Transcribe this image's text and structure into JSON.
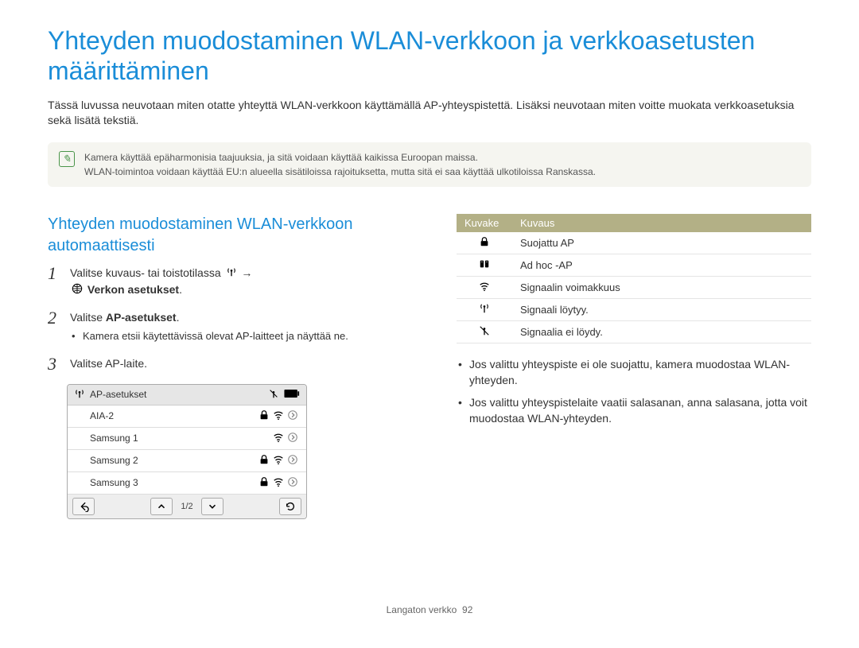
{
  "title": "Yhteyden muodostaminen WLAN-verkkoon ja verkkoasetusten määrittäminen",
  "intro": "Tässä luvussa neuvotaan miten otatte yhteyttä WLAN-verkkoon käyttämällä AP-yhteyspistettä. Lisäksi neuvotaan miten voitte  muokata verkkoasetuksia sekä lisätä tekstiä.",
  "notebox": {
    "line1": "Kamera käyttää epäharmonisia taajuuksia, ja sitä voidaan käyttää kaikissa Euroopan maissa.",
    "line2": "WLAN-toimintoa voidaan käyttää EU:n alueella sisätiloissa rajoituksetta, mutta sitä ei saa käyttää ulkotiloissa Ranskassa."
  },
  "subhead": "Yhteyden muodostaminen WLAN-verkkoon automaattisesti",
  "steps": {
    "s1_a": "Valitse kuvaus- tai toistotilassa ",
    "s1_b": " → ",
    "s1_c": " Verkon asetukset",
    "s1_d": ".",
    "s2_a": "Valitse ",
    "s2_b": "AP-asetukset",
    "s2_c": ".",
    "s2_sub": "Kamera etsii käytettävissä olevat AP-laitteet ja näyttää ne.",
    "s3": "Valitse AP-laite."
  },
  "device": {
    "title": "AP-asetukset",
    "rows": [
      {
        "name": "AIA-2",
        "lock": true,
        "wifi": true,
        "arrow": true
      },
      {
        "name": "Samsung 1",
        "lock": false,
        "wifi": true,
        "arrow": true
      },
      {
        "name": "Samsung 2",
        "lock": true,
        "wifi": true,
        "arrow": true
      },
      {
        "name": "Samsung 3",
        "lock": true,
        "wifi": true,
        "arrow": true
      }
    ],
    "page_indicator": "1/2"
  },
  "icon_table": {
    "hdr_icon": "Kuvake",
    "hdr_desc": "Kuvaus",
    "rows": [
      {
        "icon": "lock-icon",
        "desc": "Suojattu AP"
      },
      {
        "icon": "adhoc-icon",
        "desc": "Ad hoc -AP"
      },
      {
        "icon": "wifi-icon",
        "desc": "Signaalin voimakkuus"
      },
      {
        "icon": "antenna-icon",
        "desc": "Signaali löytyy."
      },
      {
        "icon": "antenna-off-icon",
        "desc": "Signaalia ei löydy."
      }
    ]
  },
  "right_bullets": [
    "Jos valittu yhteyspiste ei ole suojattu, kamera muodostaa WLAN-yhteyden.",
    "Jos valittu yhteyspistelaite vaatii salasanan, anna salasana, jotta voit muodostaa WLAN-yhteyden."
  ],
  "footer": {
    "section": "Langaton verkko",
    "page": "92"
  }
}
